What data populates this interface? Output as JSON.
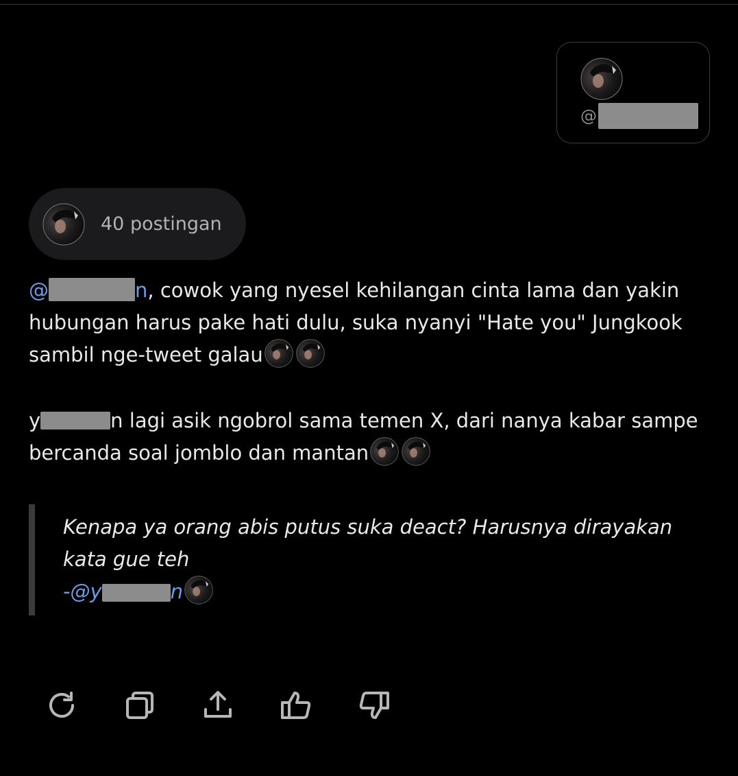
{
  "user_card": {
    "handle_prefix": "@",
    "handle_hidden": "redacted"
  },
  "posts_pill": {
    "count_label": "40 postingan"
  },
  "paragraph1": {
    "mention_start": "@",
    "mention_end": "n",
    "text": ", cowok yang nyesel kehilangan cinta lama dan yakin hubungan harus pake hati dulu, suka nyanyi \"Hate you\" Jungkook sambil nge-tweet galau",
    "emoji_count": 2
  },
  "paragraph2": {
    "name_start": "y",
    "text": "n lagi asik ngobrol sama temen X, dari nanya kabar sampe bercanda soal jomblo dan mantan",
    "emoji_count": 2
  },
  "quote": {
    "text": "Kenapa ya orang abis putus suka deact? Harusnya dirayakan kata gue teh",
    "attribution_prefix": "-@y",
    "attribution_end": "n"
  },
  "actions": [
    {
      "name": "regenerate",
      "icon": "refresh-icon"
    },
    {
      "name": "copy",
      "icon": "copy-icon"
    },
    {
      "name": "share",
      "icon": "share-icon"
    },
    {
      "name": "like",
      "icon": "thumbs-up-icon"
    },
    {
      "name": "dislike",
      "icon": "thumbs-down-icon"
    }
  ],
  "colors": {
    "background": "#000000",
    "text": "#e7e9ea",
    "mention": "#6d9bea",
    "pill_bg": "#1b1b1d",
    "icon": "#b7b7b7"
  }
}
